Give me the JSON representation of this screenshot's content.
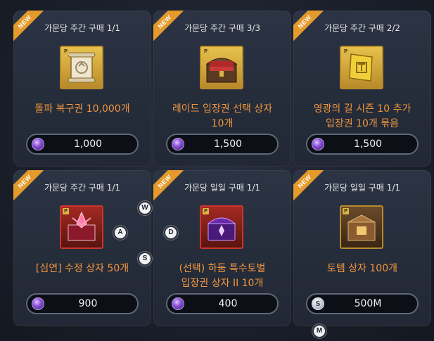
{
  "new_label": "NEW",
  "cards": [
    {
      "limit": "가문당 주간 구매 1/1",
      "name_lines": [
        "돌파 복구권 10,000개"
      ],
      "price": "1,000",
      "currency": "premium-gem",
      "item_icon": "scroll-icon"
    },
    {
      "limit": "가문당 주간 구매 3/3",
      "name_lines": [
        "레이드 입장권 선택 상자",
        "10개"
      ],
      "price": "1,500",
      "currency": "premium-gem",
      "item_icon": "treasure-chest-icon"
    },
    {
      "limit": "가문당 주간 구매 2/2",
      "name_lines": [
        "영광의 길 시즌 10 추가",
        "입장권 10개 묶음"
      ],
      "price": "1,500",
      "currency": "premium-gem",
      "item_icon": "golden-ticket-icon"
    },
    {
      "limit": "가문당 주간 구매 1/1",
      "name_lines": [
        "[심연] 수정 상자 50개"
      ],
      "price": "900",
      "currency": "premium-gem",
      "item_icon": "crystal-box-icon"
    },
    {
      "limit": "가문당 일일 구매 1/1",
      "name_lines": [
        "(선택) 하둠 특수토벌",
        "입장권 상자 II 10개"
      ],
      "price": "400",
      "currency": "premium-gem",
      "item_icon": "purple-chest-icon"
    },
    {
      "limit": "가문당 일일 구매 1/1",
      "name_lines": [
        "토템 상자 100개"
      ],
      "price": "500M",
      "currency": "silver",
      "item_icon": "totem-box-icon"
    }
  ],
  "item_badge": "P",
  "silver_symbol": "S",
  "keys": {
    "w": "W",
    "a": "A",
    "s": "S",
    "d": "D",
    "m": "M"
  }
}
